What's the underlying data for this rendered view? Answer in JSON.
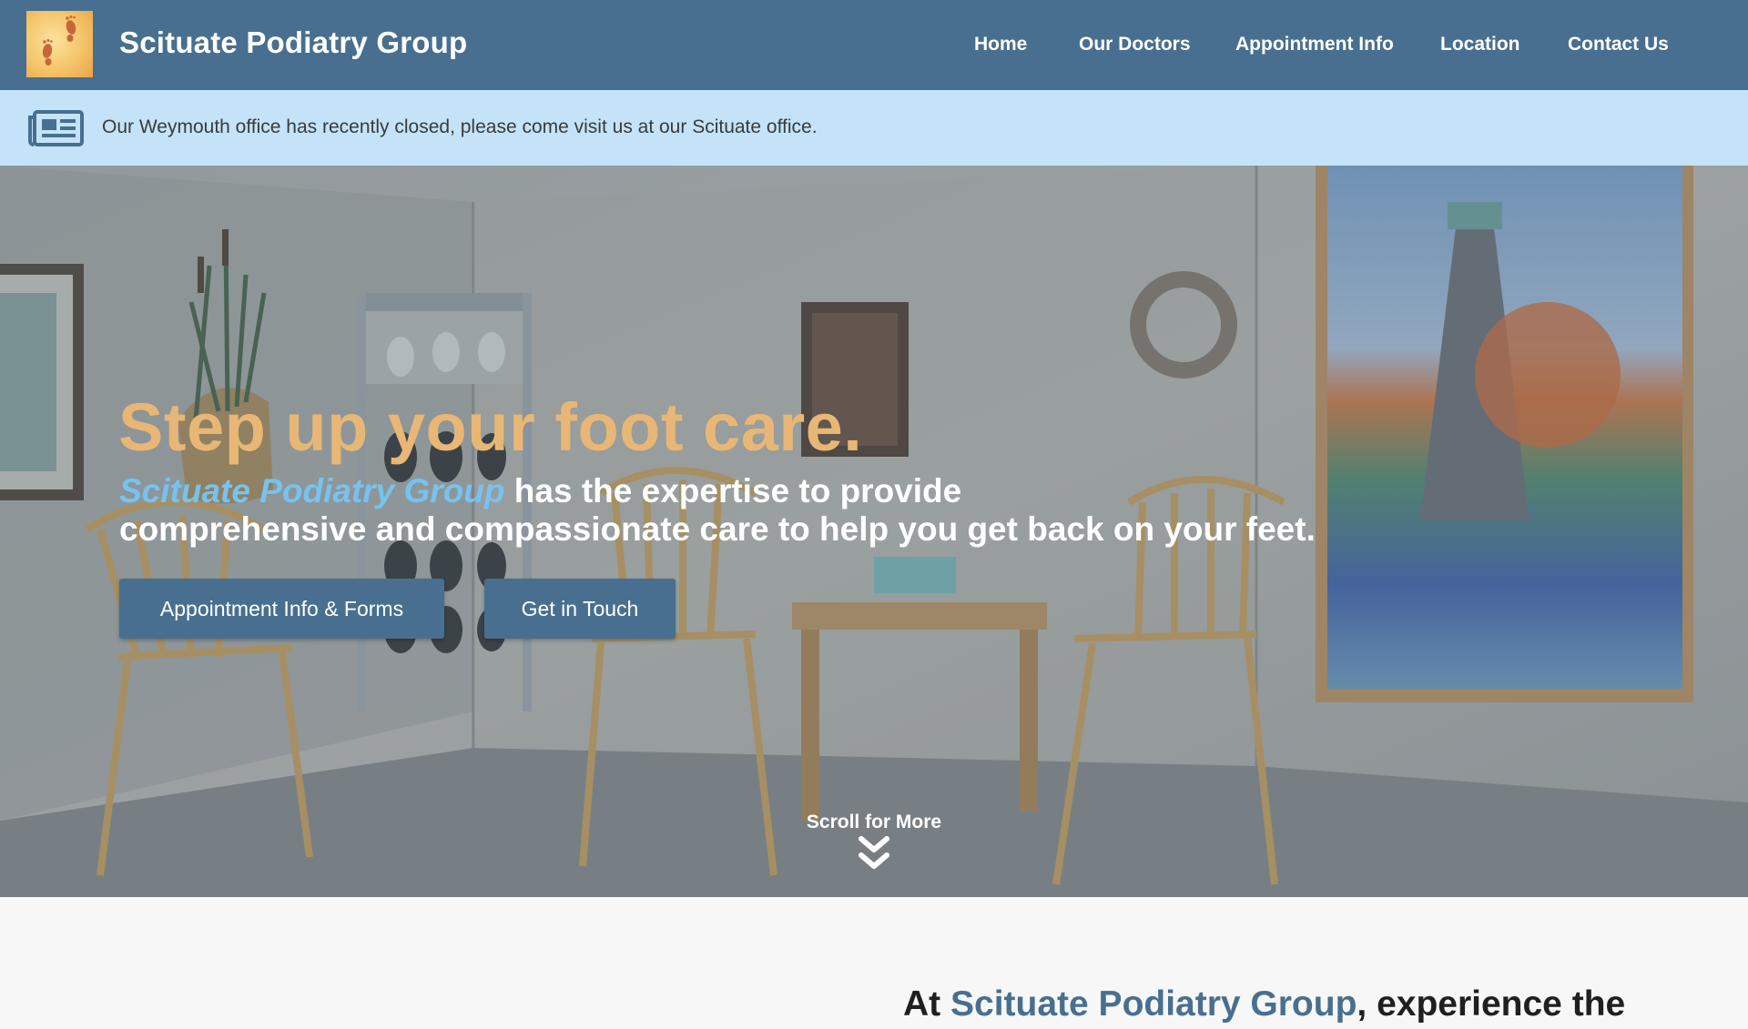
{
  "header": {
    "brand_name": "Scituate Podiatry Group",
    "logo_icon": "footprints-icon",
    "nav": [
      {
        "label": "Home"
      },
      {
        "label": "Our Doctors"
      },
      {
        "label": "Appointment Info"
      },
      {
        "label": "Location"
      },
      {
        "label": "Contact Us"
      }
    ]
  },
  "announcement": {
    "icon": "newspaper-icon",
    "text": "Our Weymouth office has recently closed, please come visit us at our Scituate office."
  },
  "hero": {
    "headline": "Step up your foot care.",
    "sub_brand": "Scituate Podiatry Group",
    "sub_text_line1": " has the expertise to provide",
    "sub_text_line2": "comprehensive and compassionate care to help you get back on your feet.",
    "buttons": {
      "forms": "Appointment Info & Forms",
      "touch": "Get in Touch"
    },
    "scroll_label": "Scroll for More",
    "scroll_icon": "double-chevron-down-icon"
  },
  "intro": {
    "prefix": "At ",
    "brand": "Scituate Podiatry Group",
    "suffix": ", experience the"
  },
  "colors": {
    "nav_bg": "#486f8f",
    "announce_bg": "#c5e3f8",
    "headline": "#e8b775",
    "brand_em": "#76c3ef",
    "button_bg": "#486f8f"
  }
}
